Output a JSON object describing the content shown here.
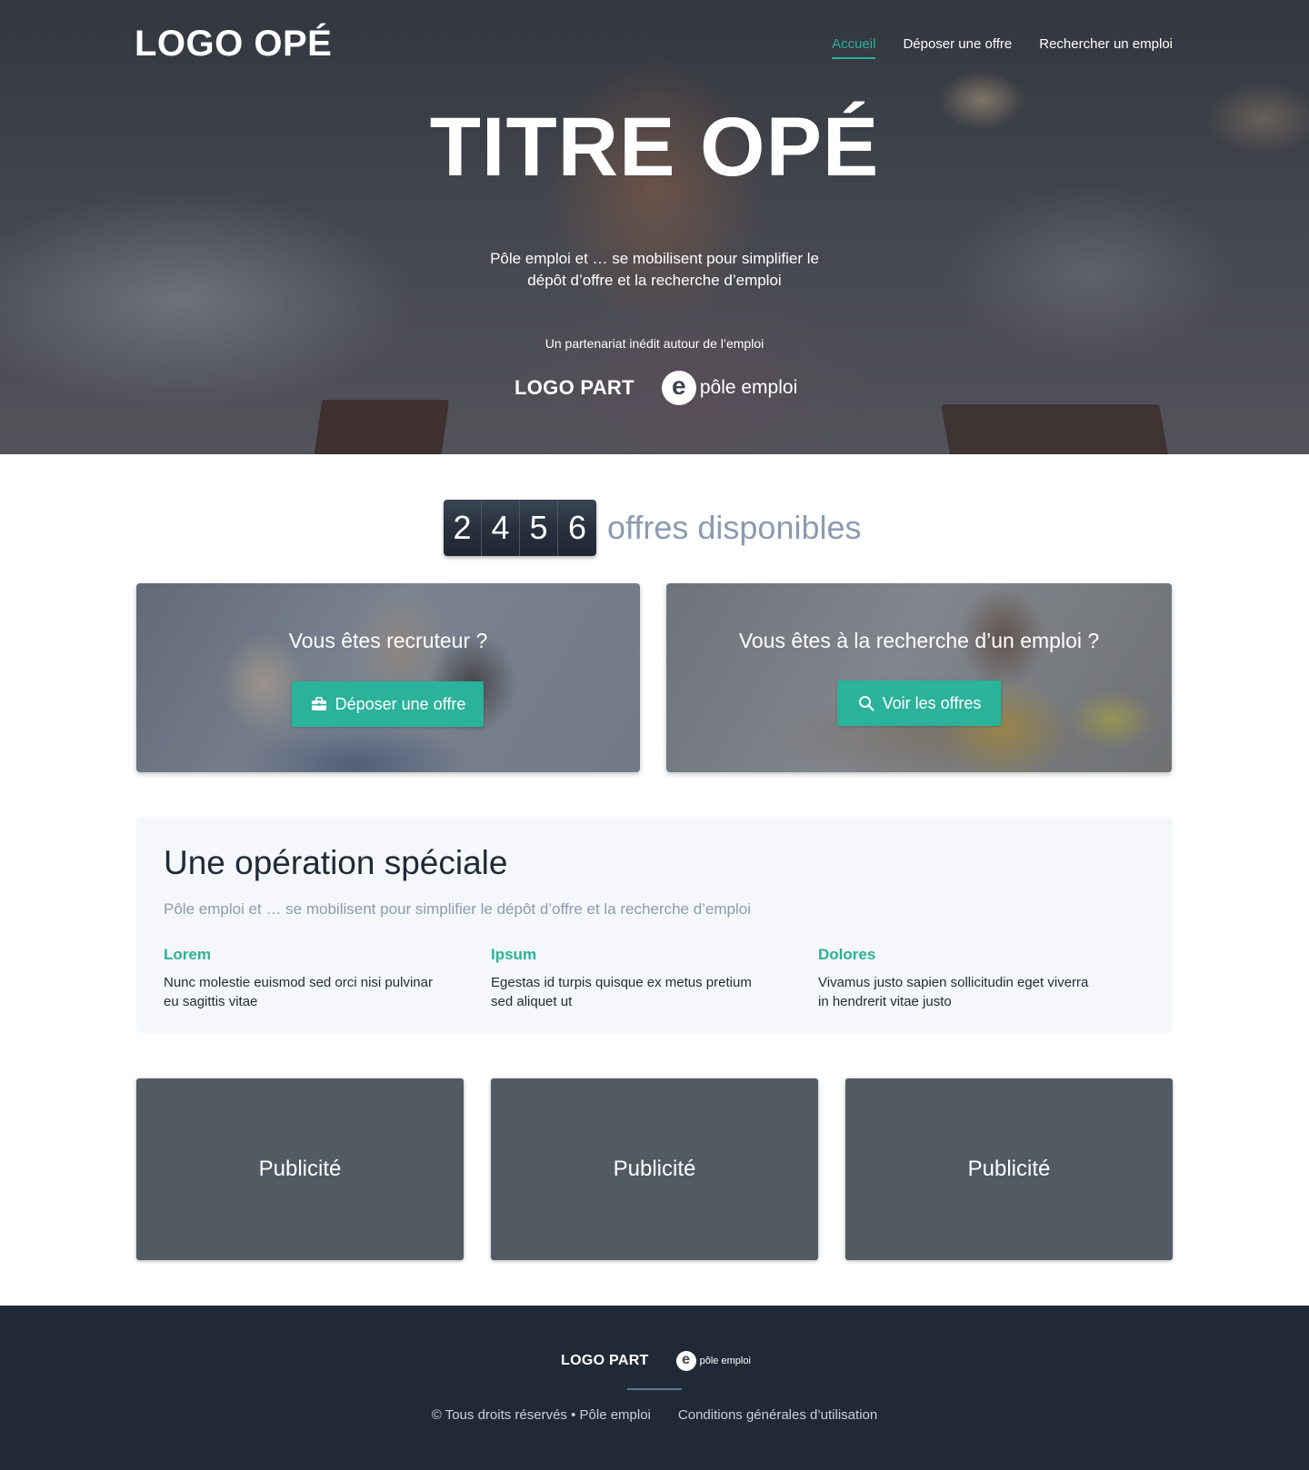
{
  "header": {
    "logo": "LOGO OPÉ",
    "nav": [
      {
        "label": "Accueil",
        "active": true
      },
      {
        "label": "Déposer une offre",
        "active": false
      },
      {
        "label": "Rechercher un emploi",
        "active": false
      }
    ]
  },
  "hero": {
    "title": "TITRE OPÉ",
    "subtitle_line1": "Pôle emploi et … se mobilisent pour simplifier le",
    "subtitle_line2": "dépôt d’offre et la recherche d’emploi",
    "partner_text": "Un partenariat inédit autour de l’emploi",
    "logo_part": "LOGO PART",
    "pole_emploi_mark": "e",
    "pole_emploi_text": "pôle emploi"
  },
  "counter": {
    "digits": [
      "2",
      "4",
      "5",
      "6"
    ],
    "label": "offres disponibles"
  },
  "cta": {
    "recruiter": {
      "title": "Vous êtes recruteur ?",
      "button": "Déposer une offre",
      "icon": "briefcase-icon"
    },
    "seeker": {
      "title": "Vous êtes à la recherche d’un emploi ?",
      "button": "Voir les offres",
      "icon": "search-icon"
    }
  },
  "special": {
    "title": "Une opération spéciale",
    "subtitle": "Pôle emploi et … se mobilisent pour simplifier le dépôt d’offre et la recherche d’emploi",
    "columns": [
      {
        "title": "Lorem",
        "text": "Nunc molestie euismod sed orci nisi pulvinar eu sagittis vitae"
      },
      {
        "title": "Ipsum",
        "text": "Egestas id turpis quisque ex metus pretium sed aliquet ut"
      },
      {
        "title": "Dolores",
        "text": "Vivamus justo sapien sollicitudin eget viverra in hendrerit vitae justo"
      }
    ]
  },
  "ads": [
    "Publicité",
    "Publicité",
    "Publicité"
  ],
  "footer": {
    "logo_part": "LOGO PART",
    "pole_emploi_mark": "e",
    "pole_emploi_text": "pôle emploi",
    "copyright": "© Tous droits réservés • Pôle emploi",
    "terms": "Conditions générales d’utilisation"
  },
  "colors": {
    "accent": "#2bb29a",
    "footer_bg": "#202a37",
    "ad_bg": "#525a64",
    "muted_text": "#8b9bb0"
  }
}
